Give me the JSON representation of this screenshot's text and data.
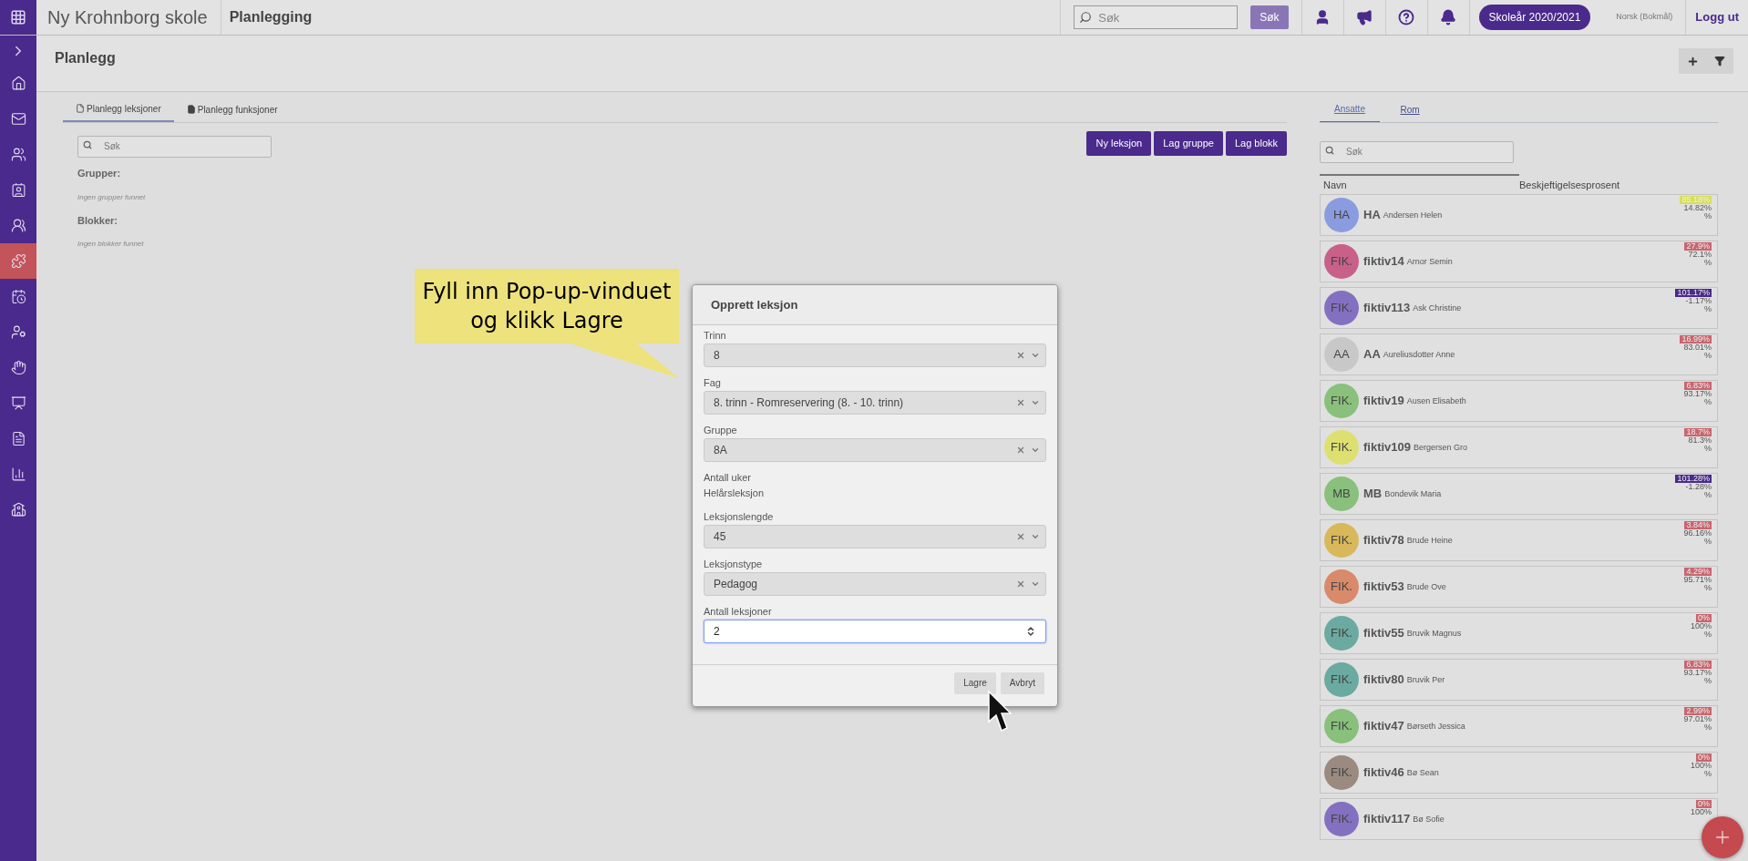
{
  "app": {
    "school": "Ny Krohnborg skole",
    "module": "Planlegging",
    "search": {
      "placeholder": "Søk"
    },
    "search_button": "Søk",
    "year_button": "Skoleår 2020/2021",
    "language": "Norsk (Bokmål)",
    "logout": "Logg ut"
  },
  "sidebar": {
    "items": [
      {
        "selected": false
      },
      {
        "selected": false
      },
      {
        "selected": false
      },
      {
        "selected": false
      },
      {
        "selected": false
      },
      {
        "selected": true
      },
      {
        "selected": false
      },
      {
        "selected": false
      },
      {
        "selected": false
      },
      {
        "selected": false
      },
      {
        "selected": false
      },
      {
        "selected": false
      },
      {
        "selected": false
      }
    ]
  },
  "page": {
    "title": "Planlegg",
    "tabs": [
      {
        "label": "Planlegg leksjoner",
        "selected": true
      },
      {
        "label": "Planlegg funksjoner",
        "selected": false
      }
    ],
    "search": {
      "placeholder": "Søk"
    },
    "buttons": [
      "Ny leksjon",
      "Lag gruppe",
      "Lag blokk"
    ],
    "sections": [
      {
        "title": "Grupper:",
        "empty": "Ingen grupper funnet"
      },
      {
        "title": "Blokker:",
        "empty": "Ingen blokker funnet"
      }
    ]
  },
  "staff_panel": {
    "tabs": [
      {
        "label": "Ansatte",
        "selected": true
      },
      {
        "label": "Rom",
        "selected": false
      }
    ],
    "search": {
      "placeholder": "Søk"
    },
    "columns": [
      "Navn",
      "Beskjeftigelsesprosent"
    ],
    "rows": [
      {
        "initials": "HA",
        "code": "HA",
        "name": "Andersen Helen",
        "color": "#8a9be0",
        "badge": {
          "text": "85.18%",
          "color": "#d6df5c"
        },
        "remaining": "14.82%",
        "unit": "%"
      },
      {
        "initials": "FIK.",
        "code": "fiktiv14",
        "name": "Arnor Semin",
        "color": "#c8608a",
        "badge": {
          "text": "27.9%",
          "color": "#c8666f"
        },
        "remaining": "72.1%",
        "unit": "%"
      },
      {
        "initials": "FIK.",
        "code": "fiktiv113",
        "name": "Ask Christine",
        "color": "#8470c0",
        "badge": {
          "text": "101.17%",
          "color": "#4a2a8c"
        },
        "remaining": "-1.17%",
        "unit": "%"
      },
      {
        "initials": "AA",
        "code": "AA",
        "name": "Aureliusdotter Anne",
        "color": "#c8c8c8",
        "badge": {
          "text": "16.99%",
          "color": "#c8666f"
        },
        "remaining": "83.01%",
        "unit": "%"
      },
      {
        "initials": "FIK.",
        "code": "fiktiv19",
        "name": "Ausen Elisabeth",
        "color": "#88c07c",
        "badge": {
          "text": "6.83%",
          "color": "#c8666f"
        },
        "remaining": "93.17%",
        "unit": "%"
      },
      {
        "initials": "FIK.",
        "code": "fiktiv109",
        "name": "Bergersen Gro",
        "color": "#dde070",
        "badge": {
          "text": "18.7%",
          "color": "#c8666f"
        },
        "remaining": "81.3%",
        "unit": "%"
      },
      {
        "initials": "MB",
        "code": "MB",
        "name": "Bondevik Maria",
        "color": "#88c07c",
        "badge": {
          "text": "101.28%",
          "color": "#4a2a8c"
        },
        "remaining": "-1.28%",
        "unit": "%"
      },
      {
        "initials": "FIK.",
        "code": "fiktiv78",
        "name": "Brude Heine",
        "color": "#d8b85a",
        "badge": {
          "text": "3.84%",
          "color": "#c8666f"
        },
        "remaining": "96.16%",
        "unit": "%"
      },
      {
        "initials": "FIK.",
        "code": "fiktiv53",
        "name": "Brude Ove",
        "color": "#d88a6a",
        "badge": {
          "text": "4.29%",
          "color": "#c8666f"
        },
        "remaining": "95.71%",
        "unit": "%"
      },
      {
        "initials": "FIK.",
        "code": "fiktiv55",
        "name": "Bruvik Magnus",
        "color": "#6aaaa0",
        "badge": {
          "text": "0%",
          "color": "#c8666f"
        },
        "remaining": "100%",
        "unit": "%"
      },
      {
        "initials": "FIK.",
        "code": "fiktiv80",
        "name": "Bruvik Per",
        "color": "#6aaaa0",
        "badge": {
          "text": "6.83%",
          "color": "#c8666f"
        },
        "remaining": "93.17%",
        "unit": "%"
      },
      {
        "initials": "FIK.",
        "code": "fiktiv47",
        "name": "Børseth Jessica",
        "color": "#88c07c",
        "badge": {
          "text": "2.99%",
          "color": "#c8666f"
        },
        "remaining": "97.01%",
        "unit": "%"
      },
      {
        "initials": "FIK.",
        "code": "fiktiv46",
        "name": "Bø Sean",
        "color": "#9a8a80",
        "badge": {
          "text": "0%",
          "color": "#c8666f"
        },
        "remaining": "100%",
        "unit": "%"
      },
      {
        "initials": "FIK.",
        "code": "fiktiv117",
        "name": "Bø Sofie",
        "color": "#8470c0",
        "badge": {
          "text": "0%",
          "color": "#c8666f"
        },
        "remaining": "100%"
      }
    ]
  },
  "callout": {
    "lines": [
      "Fyll inn Pop-up-vinduet",
      "og klikk Lagre"
    ]
  },
  "dialog": {
    "title": "Opprett leksjon",
    "fields": [
      {
        "kind": "select",
        "label": "Trinn",
        "value": "8"
      },
      {
        "kind": "select",
        "label": "Fag",
        "value": "8. trinn - Romreservering (8. - 10. trinn)"
      },
      {
        "kind": "select",
        "label": "Gruppe",
        "value": "8A"
      },
      {
        "kind": "info",
        "label": "Antall uker",
        "value": "Helårsleksjon"
      },
      {
        "kind": "select",
        "label": "Leksjonslengde",
        "value": "45"
      },
      {
        "kind": "select",
        "label": "Leksjonstype",
        "value": "Pedagog"
      },
      {
        "kind": "number",
        "label": "Antall leksjoner",
        "value": "2"
      }
    ],
    "buttons": [
      "Lagre",
      "Avbryt"
    ]
  }
}
